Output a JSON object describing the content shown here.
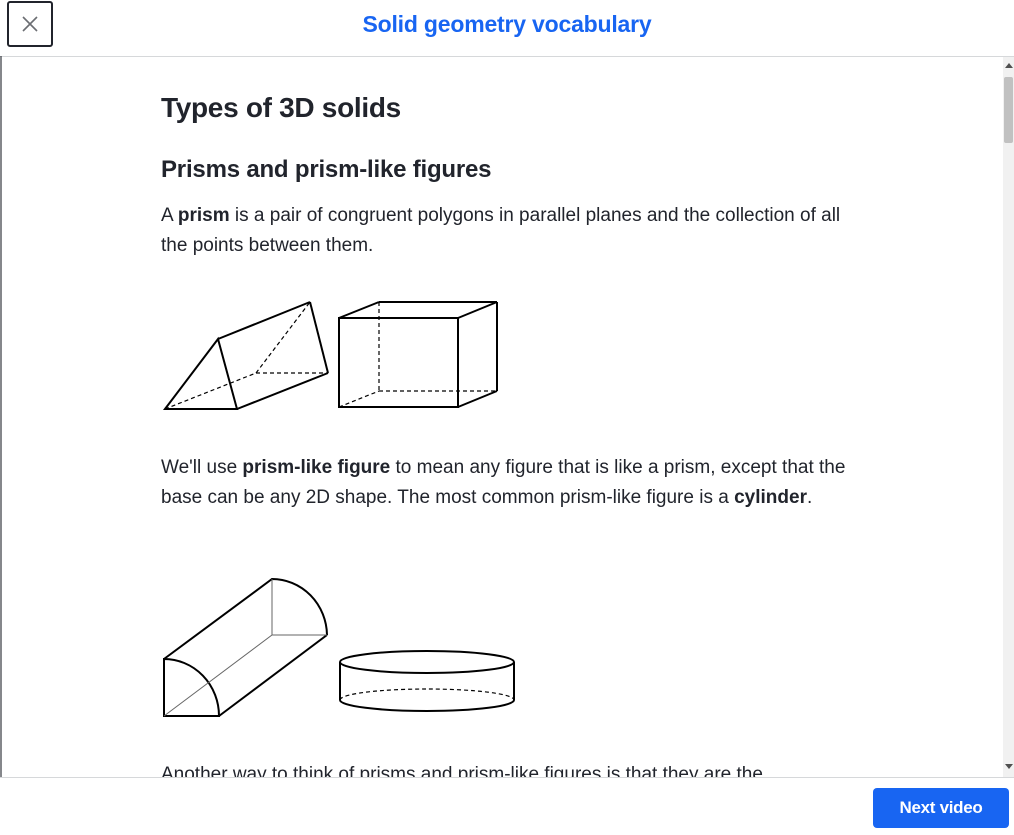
{
  "header": {
    "title": "Solid geometry vocabulary",
    "close_icon": "close-icon"
  },
  "content": {
    "section_title": "Types of 3D solids",
    "subsection_title": "Prisms and prism-like figures",
    "para1": {
      "pre": "A ",
      "bold": "prism",
      "post": " is a pair of congruent polygons in parallel planes and the collection of all the points between them."
    },
    "para2": {
      "pre": "We'll use ",
      "bold1": "prism-like figure",
      "mid": " to mean any figure that is like a prism, except that the base can be any 2D shape. The most common prism-like figure is a ",
      "bold2": "cylinder",
      "post": "."
    },
    "para3_partial": "Another way to think of prisms and prism-like figures is that they are the"
  },
  "footer": {
    "next_label": "Next video"
  },
  "colors": {
    "accent": "#1865f2",
    "text": "#21242c",
    "divider": "#d6d8da"
  }
}
